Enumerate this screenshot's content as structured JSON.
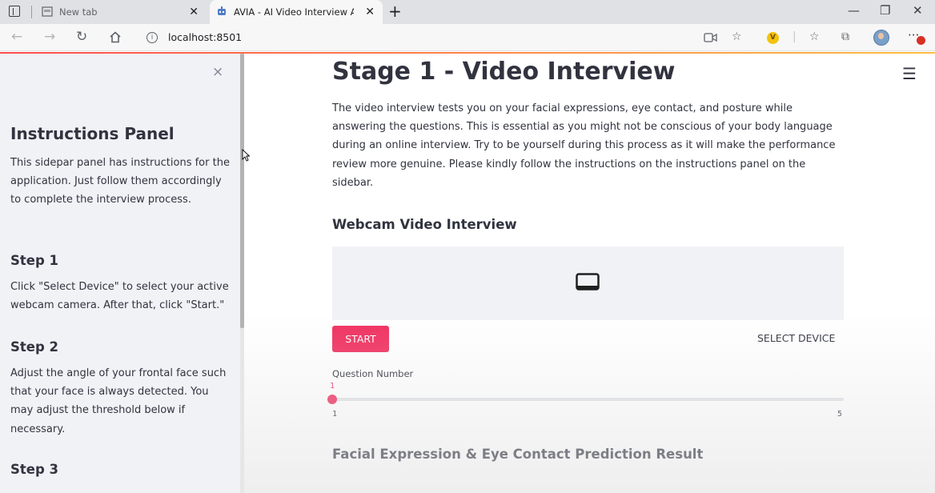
{
  "browser": {
    "tabs": [
      {
        "title": "New tab"
      },
      {
        "title": "AVIA - AI Video Interview Analyz"
      }
    ],
    "address": "localhost:8501"
  },
  "sidebar": {
    "close_symbol": "×",
    "title": "Instructions Panel",
    "intro": "This sidepar panel has instructions for the application. Just follow them accordingly to complete the interview process.",
    "steps": [
      {
        "heading": "Step 1",
        "text": "Click \"Select Device\" to select your active webcam camera. After that, click \"Start.\""
      },
      {
        "heading": "Step 2",
        "text": "Adjust the angle of your frontal face such that your face is always detected. You may adjust the threshold below if necessary."
      },
      {
        "heading": "Step 3",
        "text": ""
      }
    ]
  },
  "main": {
    "title": "Stage 1 - Video Interview",
    "description": "The video interview tests you on your facial expressions, eye contact, and posture while answering the questions. This is essential as you might not be conscious of your body language during an online interview. Try to be yourself during this process as it will make the performance review more genuine. Please kindly follow the instructions on the instructions panel on the sidebar.",
    "webcam_heading": "Webcam Video Interview",
    "start_label": "START",
    "select_device_label": "SELECT DEVICE",
    "slider": {
      "label": "Question Number",
      "value": "1",
      "min": "1",
      "max": "5"
    },
    "result_heading": "Facial Expression & Eye Contact Prediction Result"
  },
  "colors": {
    "accent": "#f0305f",
    "sidebar_bg": "#f0f2f6",
    "text": "#31333f"
  }
}
